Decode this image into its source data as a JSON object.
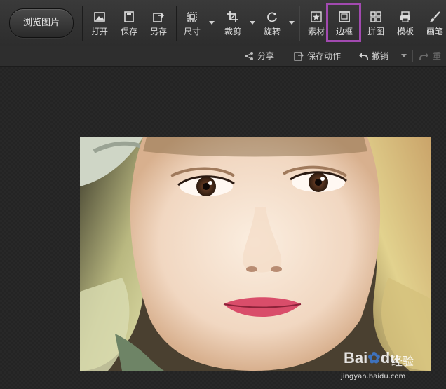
{
  "toolbar": {
    "browse_label": "浏览图片",
    "tools": [
      {
        "key": "open",
        "label": "打开",
        "icon": "open-icon"
      },
      {
        "key": "save",
        "label": "保存",
        "icon": "save-icon"
      },
      {
        "key": "save_as",
        "label": "另存",
        "icon": "save-as-icon"
      },
      {
        "key": "resize",
        "label": "尺寸",
        "icon": "resize-icon"
      },
      {
        "key": "crop",
        "label": "裁剪",
        "icon": "crop-icon"
      },
      {
        "key": "rotate",
        "label": "旋转",
        "icon": "rotate-icon"
      },
      {
        "key": "material",
        "label": "素材",
        "icon": "star-icon"
      },
      {
        "key": "border",
        "label": "边框",
        "icon": "border-frame-icon"
      },
      {
        "key": "collage",
        "label": "拼图",
        "icon": "grid-icon"
      },
      {
        "key": "template",
        "label": "模板",
        "icon": "template-icon"
      },
      {
        "key": "brush",
        "label": "画笔",
        "icon": "brush-icon"
      }
    ],
    "highlight_color": "#a24ab0"
  },
  "subbar": {
    "share": "分享",
    "save_action": "保存动作",
    "undo": "撤销",
    "redo": "重做"
  },
  "watermark": {
    "logo_bai": "Bai",
    "logo_du": "du",
    "brand": "经验",
    "url": "jingyan.baidu.com"
  }
}
